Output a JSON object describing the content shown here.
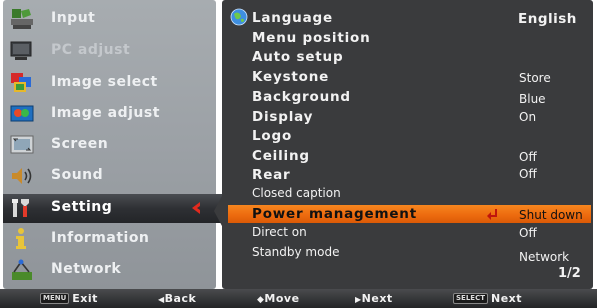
{
  "left_menu": {
    "items": [
      {
        "label": "Input",
        "icon": "input-icon"
      },
      {
        "label": "PC adjust",
        "icon": "pc-adjust-icon"
      },
      {
        "label": "Image select",
        "icon": "image-select-icon"
      },
      {
        "label": "Image adjust",
        "icon": "image-adjust-icon"
      },
      {
        "label": "Screen",
        "icon": "screen-icon"
      },
      {
        "label": "Sound",
        "icon": "sound-icon"
      },
      {
        "label": "Setting",
        "icon": "setting-icon"
      },
      {
        "label": "Information",
        "icon": "information-icon"
      },
      {
        "label": "Network",
        "icon": "network-icon"
      }
    ],
    "active_index": 6
  },
  "settings": {
    "rows": [
      {
        "label": "Language",
        "value": "English"
      },
      {
        "label": "Menu position",
        "value": ""
      },
      {
        "label": "Auto setup",
        "value": ""
      },
      {
        "label": "Keystone",
        "value": "Store"
      },
      {
        "label": "Background",
        "value": "Blue"
      },
      {
        "label": "Display",
        "value": "On"
      },
      {
        "label": "Logo",
        "value": ""
      },
      {
        "label": "Ceiling",
        "value": "Off"
      },
      {
        "label": "Rear",
        "value": "Off"
      },
      {
        "label": "Closed caption",
        "value": ""
      },
      {
        "label": "Power management",
        "value": "Shut down"
      },
      {
        "label": "Direct on",
        "value": "Off"
      },
      {
        "label": "Standby mode",
        "value": "Network"
      }
    ],
    "active_index": 10,
    "page_indicator": "1/2"
  },
  "bottom_bar": {
    "exit": {
      "key": "MENU",
      "label": "Exit"
    },
    "back": {
      "symbol": "◀",
      "label": "Back"
    },
    "move": {
      "symbol": "◆",
      "label": "Move"
    },
    "next": {
      "symbol": "▶",
      "label": "Next"
    },
    "select": {
      "key": "SELECT",
      "label": "Next"
    }
  },
  "colors": {
    "highlight": "#f0731a",
    "panel_bg": "#3a3b3d",
    "left_bg": "#9ca1a6"
  }
}
